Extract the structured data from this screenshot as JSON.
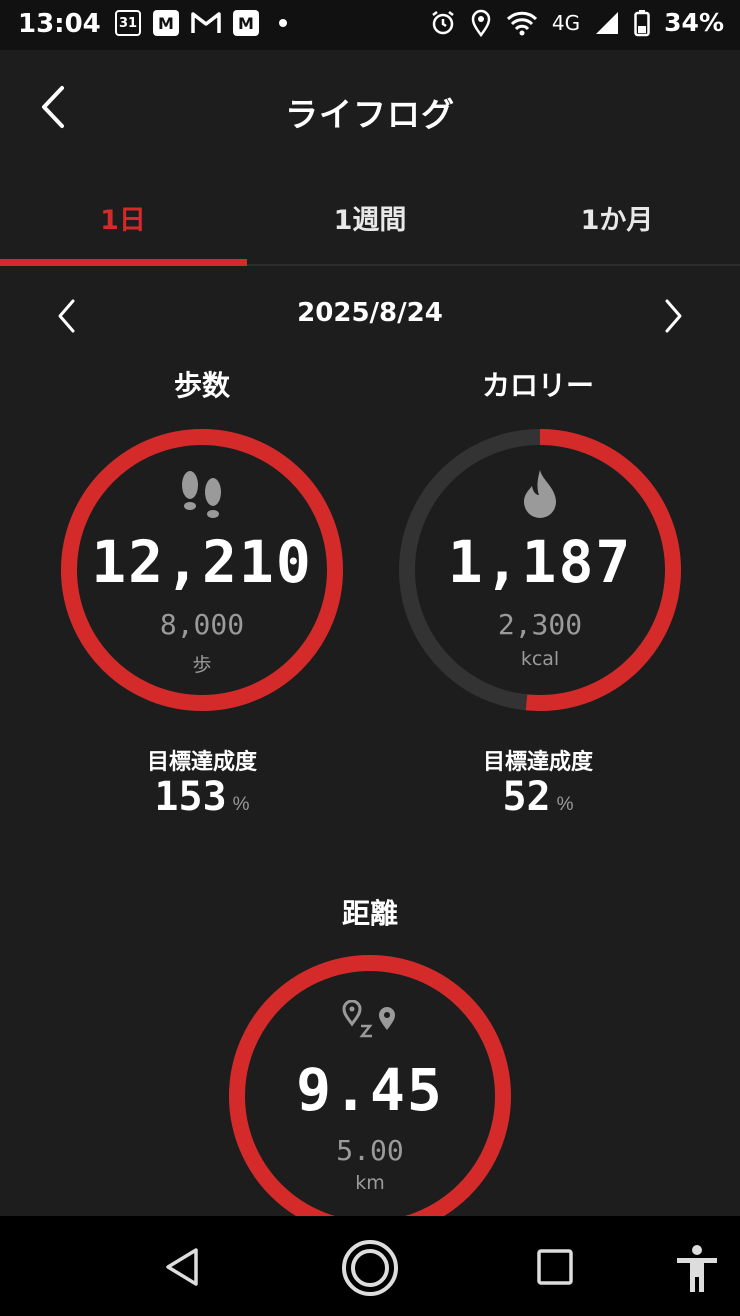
{
  "status_bar": {
    "time": "13:04",
    "calendar_day": "31",
    "mail_letter_1": "M",
    "mail_letter_2": "M",
    "network": "4G",
    "battery": "34%"
  },
  "header": {
    "title": "ライフログ"
  },
  "tabs": [
    {
      "label": "1日",
      "active": true
    },
    {
      "label": "1週間",
      "active": false
    },
    {
      "label": "1か月",
      "active": false
    }
  ],
  "date_nav": {
    "date": "2025/8/24"
  },
  "steps": {
    "label": "歩数",
    "value": "12,210",
    "goal": "8,000",
    "unit": "歩",
    "achievement_label": "目標達成度",
    "achievement": "153",
    "pct_symbol": "%",
    "progress_fraction": 1.0
  },
  "calories": {
    "label": "カロリー",
    "value": "1,187",
    "goal": "2,300",
    "unit": "kcal",
    "achievement_label": "目標達成度",
    "achievement": "52",
    "pct_symbol": "%",
    "progress_fraction": 0.516
  },
  "distance": {
    "label": "距離",
    "value": "9.45",
    "goal": "5.00",
    "unit": "km",
    "progress_fraction": 1.0
  },
  "colors": {
    "accent": "#d42a2a",
    "ring_track": "#333333",
    "background": "#1d1d1d"
  }
}
